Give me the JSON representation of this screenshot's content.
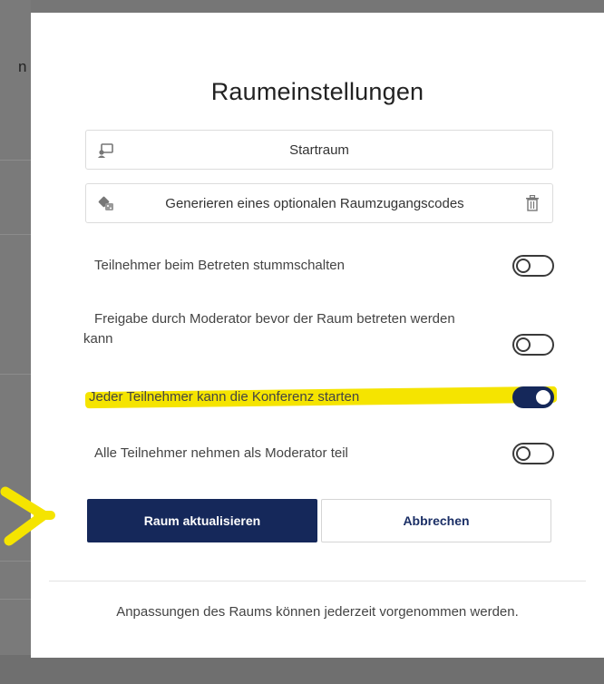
{
  "background": {
    "visible_letter": "n"
  },
  "modal": {
    "title": "Raumeinstellungen",
    "room_name_field": {
      "value": "Startraum",
      "icon": "room-icon"
    },
    "access_code_field": {
      "value": "Generieren eines optionalen Raumzugangscodes",
      "icon": "dice-icon",
      "action_icon": "trash-icon"
    },
    "options": [
      {
        "label": "Teilnehmer beim Betreten stummschalten",
        "enabled": false
      },
      {
        "label_line1": "Freigabe durch Moderator bevor der Raum betreten werden",
        "label_line2": "kann",
        "enabled": false
      },
      {
        "label": "Jeder Teilnehmer kann die Konferenz starten",
        "enabled": true,
        "highlighted": true
      },
      {
        "label": "Alle Teilnehmer nehmen als Moderator teil",
        "enabled": false
      }
    ],
    "buttons": {
      "update": "Raum aktualisieren",
      "cancel": "Abbrechen"
    },
    "footer_note": "Anpassungen des Raums können jederzeit vorgenommen werden."
  },
  "colors": {
    "primary": "#15285a",
    "highlight": "#f5e400"
  }
}
